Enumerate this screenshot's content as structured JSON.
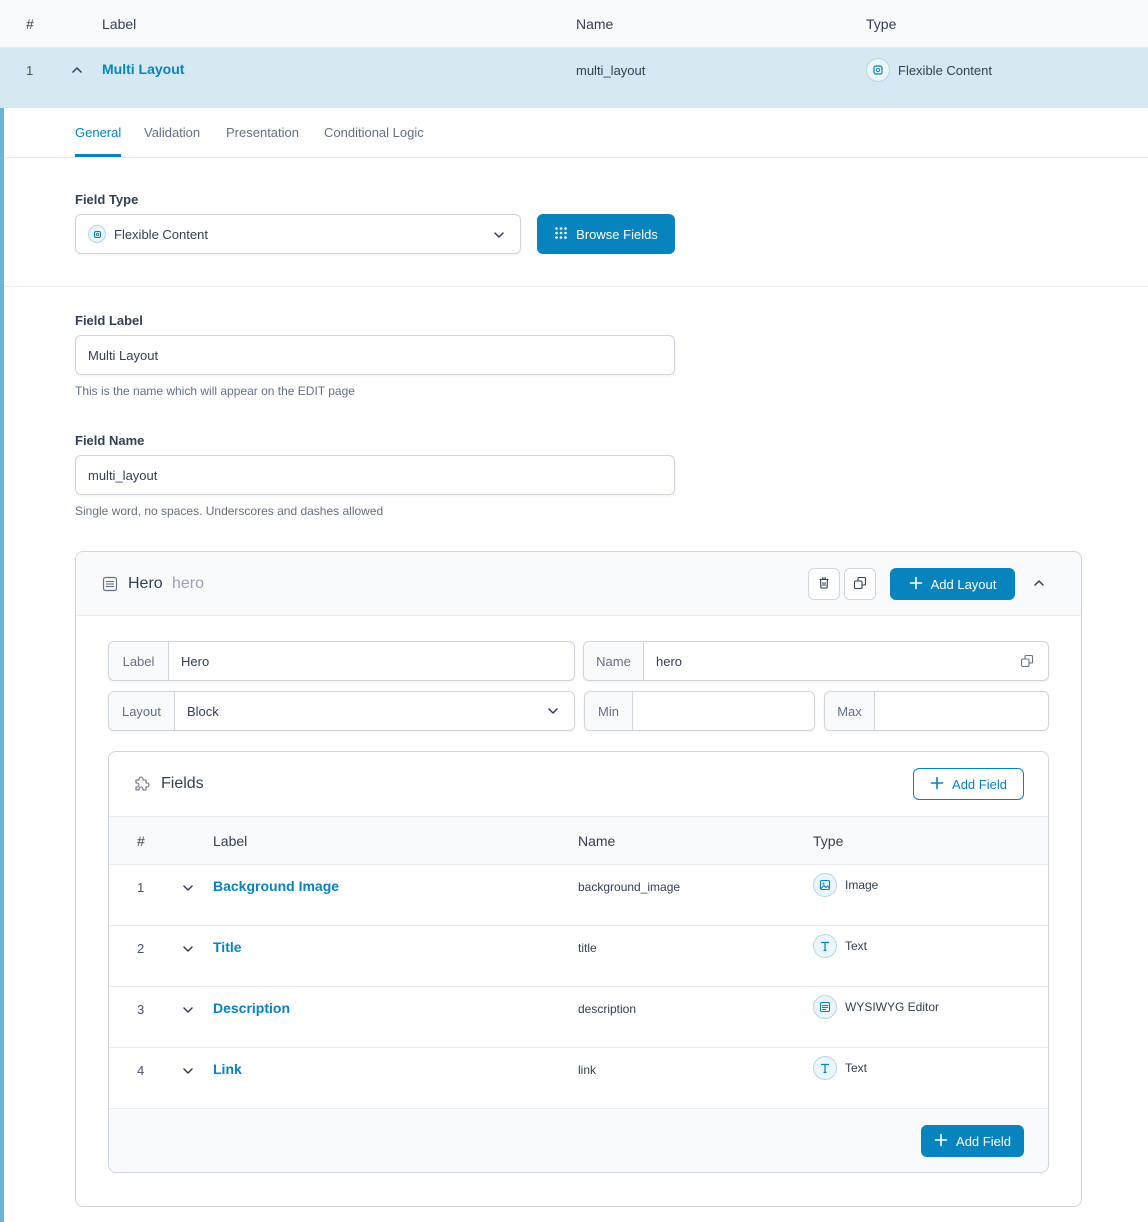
{
  "table_header": {
    "num": "#",
    "label": "Label",
    "name": "Name",
    "type": "Type"
  },
  "field": {
    "num": "1",
    "label": "Multi Layout",
    "name": "multi_layout",
    "type": "Flexible Content",
    "type_icon": "flexible-content-icon"
  },
  "tabs": [
    {
      "label": "General",
      "active": true
    },
    {
      "label": "Validation",
      "active": false
    },
    {
      "label": "Presentation",
      "active": false
    },
    {
      "label": "Conditional Logic",
      "active": false
    }
  ],
  "field_type": {
    "label": "Field Type",
    "value": "Flexible Content",
    "browse_label": "Browse Fields"
  },
  "field_label": {
    "label": "Field Label",
    "value": "Multi Layout",
    "help": "This is the name which will appear on the EDIT page"
  },
  "field_name": {
    "label": "Field Name",
    "value": "multi_layout",
    "help": "Single word, no spaces. Underscores and dashes allowed"
  },
  "layout": {
    "title": "Hero",
    "slug": "hero",
    "add_layout_label": "Add Layout",
    "label_prefix": "Label",
    "label_value": "Hero",
    "name_prefix": "Name",
    "name_value": "hero",
    "layout_prefix": "Layout",
    "layout_value": "Block",
    "min_prefix": "Min",
    "min_value": "",
    "max_prefix": "Max",
    "max_value": ""
  },
  "fields": {
    "title": "Fields",
    "add_field_label": "Add Field",
    "headers": {
      "num": "#",
      "label": "Label",
      "name": "Name",
      "type": "Type"
    },
    "rows": [
      {
        "num": "1",
        "label": "Background Image",
        "name": "background_image",
        "type": "Image",
        "icon": "image-icon"
      },
      {
        "num": "2",
        "label": "Title",
        "name": "title",
        "type": "Text",
        "icon": "text-icon"
      },
      {
        "num": "3",
        "label": "Description",
        "name": "description",
        "type": "WYSIWYG Editor",
        "icon": "wysiwyg-icon"
      },
      {
        "num": "4",
        "label": "Link",
        "name": "link",
        "type": "Text",
        "icon": "text-icon"
      }
    ]
  },
  "colors": {
    "accent": "#0783be",
    "row_highlight": "#d6e8f2",
    "left_rule": "#6bb5d8"
  }
}
